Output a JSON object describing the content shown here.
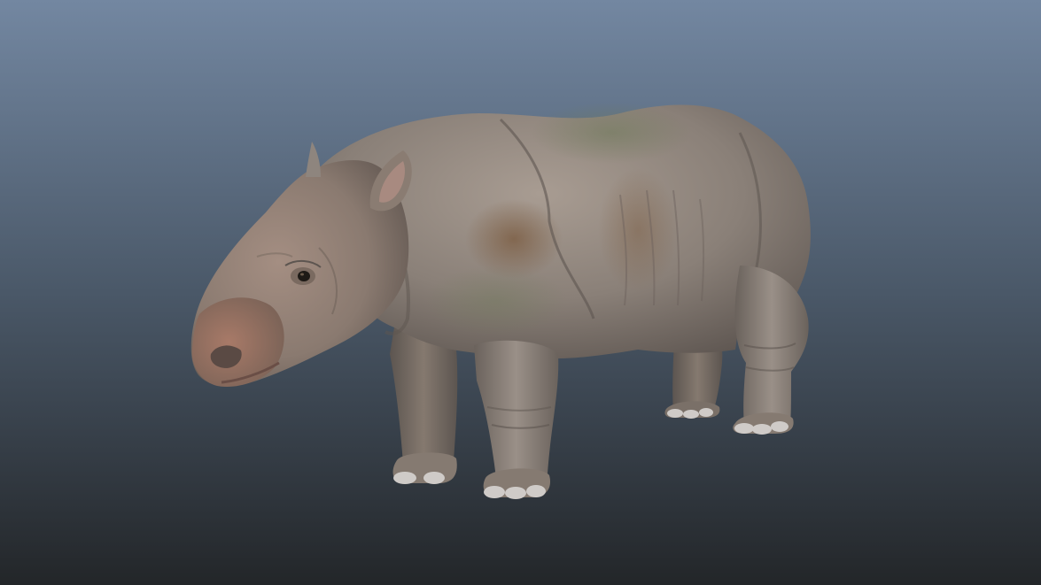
{
  "viewport": {
    "background_top_color": "#7387a1",
    "background_mid_color": "#4a5868",
    "background_bottom_color": "#232629",
    "model_name": "rhinoceros-calf"
  },
  "palette": {
    "skin_base": "#8a8078",
    "skin_light": "#a89c92",
    "skin_dark": "#5d5550",
    "skin_rust": "#8a6a50",
    "skin_moss": "#6f7a5a",
    "muzzle_pink": "#9a6e62",
    "hoof_light": "#cfcbc8",
    "eye_dark": "#1e1a16"
  }
}
